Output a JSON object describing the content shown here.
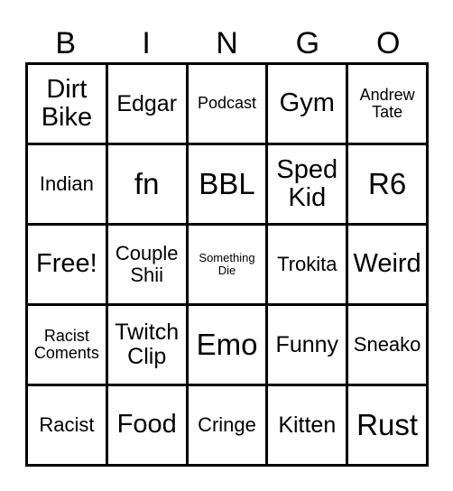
{
  "header": {
    "letters": [
      "B",
      "I",
      "N",
      "G",
      "O"
    ]
  },
  "card": {
    "rows": [
      [
        "Dirt Bike",
        "Edgar",
        "Podcast",
        "Gym",
        "Andrew Tate"
      ],
      [
        "Indian",
        "fn",
        "BBL",
        "Sped Kid",
        "R6"
      ],
      [
        "Free!",
        "Couple Shii",
        "Something Die",
        "Trokita",
        "Weird"
      ],
      [
        "Racist Coments",
        "Twitch Clip",
        "Emo",
        "Funny",
        "Sneako"
      ],
      [
        "Racist",
        "Food",
        "Cringe",
        "Kitten",
        "Rust"
      ]
    ]
  }
}
